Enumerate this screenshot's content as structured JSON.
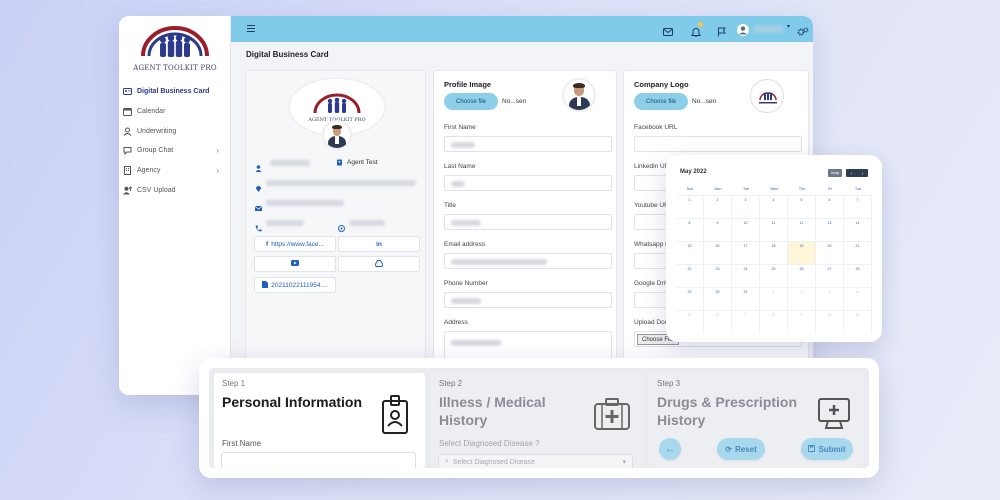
{
  "sidebar": {
    "logo_text": "AGENT TOOLKIT PRO",
    "items": [
      {
        "label": "Digital Business Card",
        "icon": "id-card-icon"
      },
      {
        "label": "Calendar",
        "icon": "calendar-icon"
      },
      {
        "label": "Underwriting",
        "icon": "user-icon"
      },
      {
        "label": "Group Chat",
        "icon": "chat-icon"
      },
      {
        "label": "Agency",
        "icon": "building-icon"
      },
      {
        "label": "CSV Upload",
        "icon": "upload-user-icon"
      }
    ]
  },
  "topbar": {
    "icons": [
      "hamburger-icon",
      "mail-icon",
      "bell-icon",
      "flag-icon",
      "avatar",
      "settings-icon"
    ],
    "accent": "#80cbe9",
    "notification_color": "#f5c542"
  },
  "page": {
    "title": "Digital Business Card"
  },
  "profile_card": {
    "agent_label": "Agent Test",
    "links": [
      {
        "label": "https://www.face...",
        "icon": "facebook-icon"
      },
      {
        "label": "in",
        "icon": "linkedin-icon"
      },
      {
        "label": "",
        "icon": "youtube-icon"
      },
      {
        "label": "",
        "icon": "drive-icon"
      },
      {
        "label": "20211022111954....",
        "icon": "file-icon"
      }
    ]
  },
  "profile_form": {
    "section_title": "Profile Image",
    "choose_label": "Choose file",
    "file_name": "No...sen",
    "fields": [
      "First Name",
      "Last Name",
      "Title",
      "Email address",
      "Phone Number",
      "Address"
    ]
  },
  "company_form": {
    "section_title": "Company Logo",
    "choose_label": "Choose file",
    "file_name": "No...sen",
    "fields": [
      "Facebook URL",
      "Linkedin UR",
      "Youtube UR",
      "Whatsapp N",
      "Google Driv",
      "Upload Doc"
    ],
    "upload_choose_label": "Choose File"
  },
  "calendar": {
    "title": "May 2022",
    "today_label": "today",
    "prev": "‹",
    "next": "›",
    "weekdays": [
      "Sun",
      "Mon",
      "Tue",
      "Wed",
      "Thu",
      "Fri",
      "Sat"
    ],
    "weeks": [
      [
        "1",
        "2",
        "3",
        "4",
        "5",
        "6",
        "7"
      ],
      [
        "8",
        "9",
        "10",
        "11",
        "12",
        "13",
        "14"
      ],
      [
        "15",
        "16",
        "17",
        "18",
        "19",
        "20",
        "21"
      ],
      [
        "22",
        "23",
        "24",
        "25",
        "26",
        "27",
        "28"
      ],
      [
        "29",
        "30",
        "31",
        "1",
        "2",
        "3",
        "4"
      ],
      [
        "5",
        "6",
        "7",
        "8",
        "9",
        "10",
        "11"
      ]
    ],
    "today_day": "19"
  },
  "wizard": {
    "steps": [
      {
        "num": "Step 1",
        "title": "Personal Information",
        "label": "First Name"
      },
      {
        "num": "Step 2",
        "title": "Illness / Medical History",
        "label": "Select Diagnosed Disease ?",
        "select_placeholder": "Select Diagnosed Disease"
      },
      {
        "num": "Step 3",
        "title": "Drugs & Prescription History"
      }
    ],
    "buttons": {
      "back": "←",
      "reset": "Reset",
      "submit": "Submit"
    }
  }
}
